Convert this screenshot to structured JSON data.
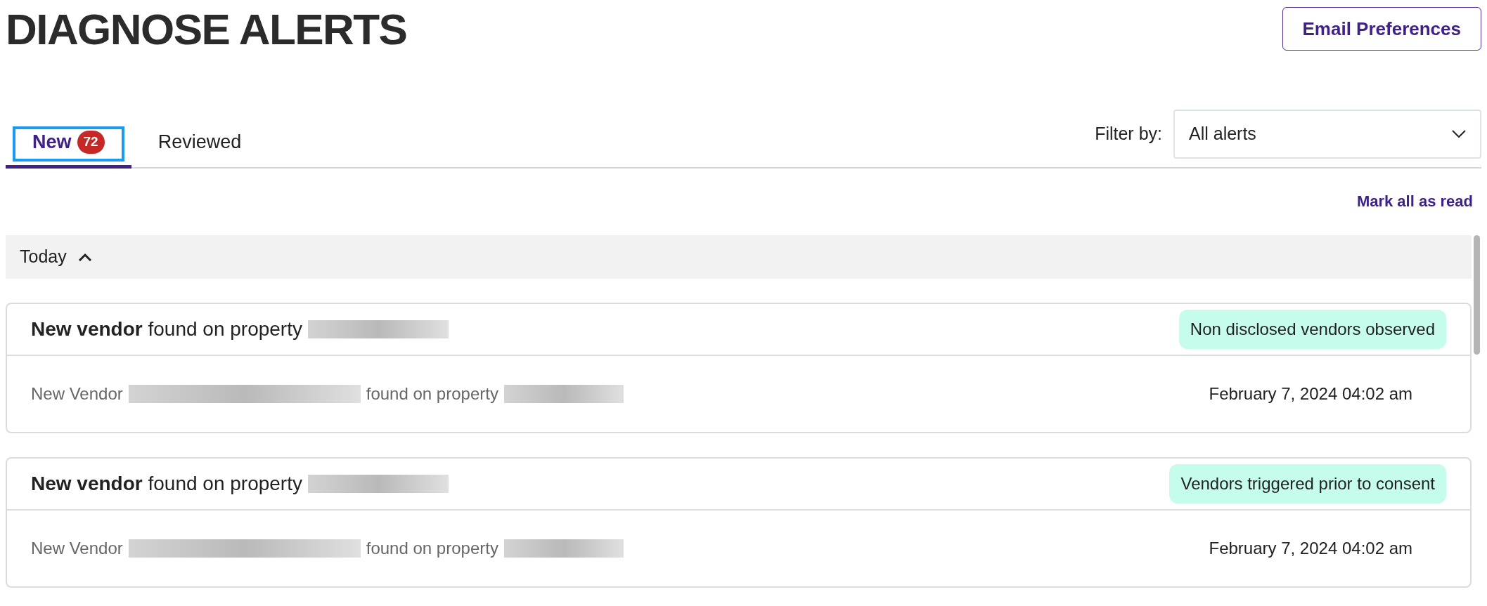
{
  "page": {
    "title": "DIAGNOSE ALERTS",
    "email_button": "Email Preferences"
  },
  "tabs": [
    {
      "label": "New",
      "badge": "72",
      "selected": true,
      "focused": true
    },
    {
      "label": "Reviewed",
      "selected": false,
      "focused": false
    }
  ],
  "filter": {
    "label": "Filter by:",
    "value": "All alerts"
  },
  "mark_all_link": "Mark all as read",
  "groups": [
    {
      "label": "Today",
      "expanded": true,
      "alerts": [
        {
          "title": "**New vendor** found on property",
          "tag": "Non disclosed vendors observed",
          "detail_start": "New Vendor",
          "detail_middle": "found on property",
          "date": "February 7, 2024 04:02 am"
        },
        {
          "title": "**New vendor** found on property",
          "tag": "Vendors triggered prior to consent",
          "detail_start": "New Vendor",
          "detail_middle": "found on property",
          "date": "February 7, 2024 04:02 am"
        }
      ]
    }
  ]
}
